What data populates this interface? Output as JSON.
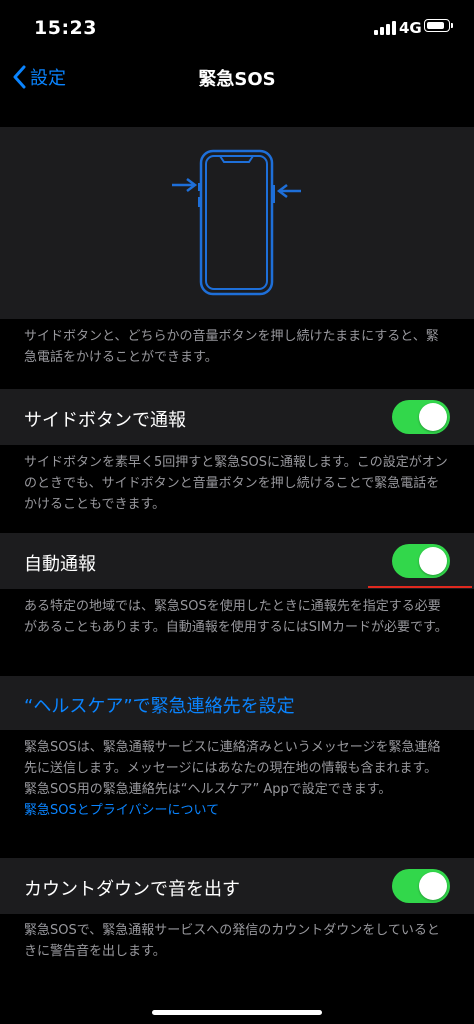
{
  "status_bar": {
    "time": "15:23",
    "network": "4G",
    "signal_icon": "cellular-signal-icon",
    "battery_icon": "battery-icon"
  },
  "nav": {
    "back_label": "設定",
    "title": "緊急SOS"
  },
  "illustration": {
    "icon": "phone-buttons-illustration",
    "accent_color": "#1e6fd9"
  },
  "intro_footer": "サイドボタンと、どちらかの音量ボタンを押し続けたままにすると、緊急電話をかけることができます。",
  "side_button": {
    "label": "サイドボタンで通報",
    "enabled": true,
    "footer": "サイドボタンを素早く5回押すと緊急SOSに通報します。この設定がオンのときでも、サイドボタンと音量ボタンを押し続けることで緊急電話をかけることもできます。"
  },
  "auto_call": {
    "label": "自動通報",
    "enabled": true,
    "footer": "ある特定の地域では、緊急SOSを使用したときに通報先を指定する必要があることもあります。自動通報を使用するにはSIMカードが必要です。"
  },
  "health_link": {
    "label": "“ヘルスケア”で緊急連絡先を設定",
    "footer": "緊急SOSは、緊急通報サービスに連絡済みというメッセージを緊急連絡先に送信します。メッセージにはあなたの現在地の情報も含まれます。緊急SOS用の緊急連絡先は“ヘルスケア” Appで設定できます。",
    "privacy_link": "緊急SOSとプライバシーについて"
  },
  "countdown": {
    "label": "カウントダウンで音を出す",
    "enabled": true,
    "footer": "緊急SOSで、緊急通報サービスへの発信のカウントダウンをしているときに警告音を出します。"
  },
  "colors": {
    "accent": "#0a84ff",
    "toggle_on": "#32d74b",
    "annotation": "#e0291f"
  }
}
